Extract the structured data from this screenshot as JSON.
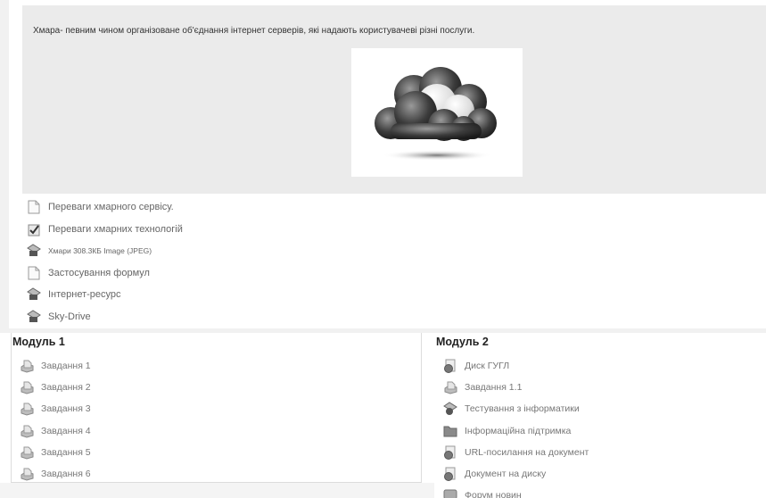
{
  "intro": {
    "text": "Хмара- певним чином організоване об'єднання інтернет серверів, які надають користувачеві різні послуги."
  },
  "resources": [
    {
      "label": "Переваги хмарного сервісу.",
      "icon": "document-icon"
    },
    {
      "label": "Переваги хмарних технологій",
      "icon": "checklist-icon"
    },
    {
      "label": "Хмари 308.3КБ Image (JPEG)",
      "icon": "image-file-icon"
    },
    {
      "label": "Застосування формул",
      "icon": "document-icon"
    },
    {
      "label": "Інтернет-ресурс",
      "icon": "web-link-icon"
    },
    {
      "label": "Sky-Drive",
      "icon": "web-link-icon"
    }
  ],
  "modules": {
    "left": {
      "title": "Модуль 1",
      "items": [
        {
          "label": "Завдання 1",
          "icon": "assignment-icon"
        },
        {
          "label": "Завдання 2",
          "icon": "assignment-icon"
        },
        {
          "label": "Завдання 3",
          "icon": "assignment-icon"
        },
        {
          "label": "Завдання 4",
          "icon": "assignment-icon"
        },
        {
          "label": "Завдання 5",
          "icon": "assignment-icon"
        },
        {
          "label": "Завдання 6",
          "icon": "assignment-icon"
        }
      ]
    },
    "right": {
      "title": "Модуль 2",
      "items": [
        {
          "label": "Диск ГУГЛ",
          "icon": "globe-link-icon"
        },
        {
          "label": "Завдання 1.1",
          "icon": "assignment-icon"
        },
        {
          "label": "Тестування з інформатики",
          "icon": "quiz-icon"
        },
        {
          "label": "Інформаційна підтримка",
          "icon": "folder-icon"
        },
        {
          "label": "URL-посилання на документ",
          "icon": "globe-link-icon"
        },
        {
          "label": "Документ на диску",
          "icon": "globe-link-icon"
        },
        {
          "label": "Форум новин",
          "icon": "forum-icon"
        }
      ]
    }
  },
  "colors": {
    "block_bg": "#ebebeb",
    "text": "#666666",
    "title": "#222222"
  }
}
